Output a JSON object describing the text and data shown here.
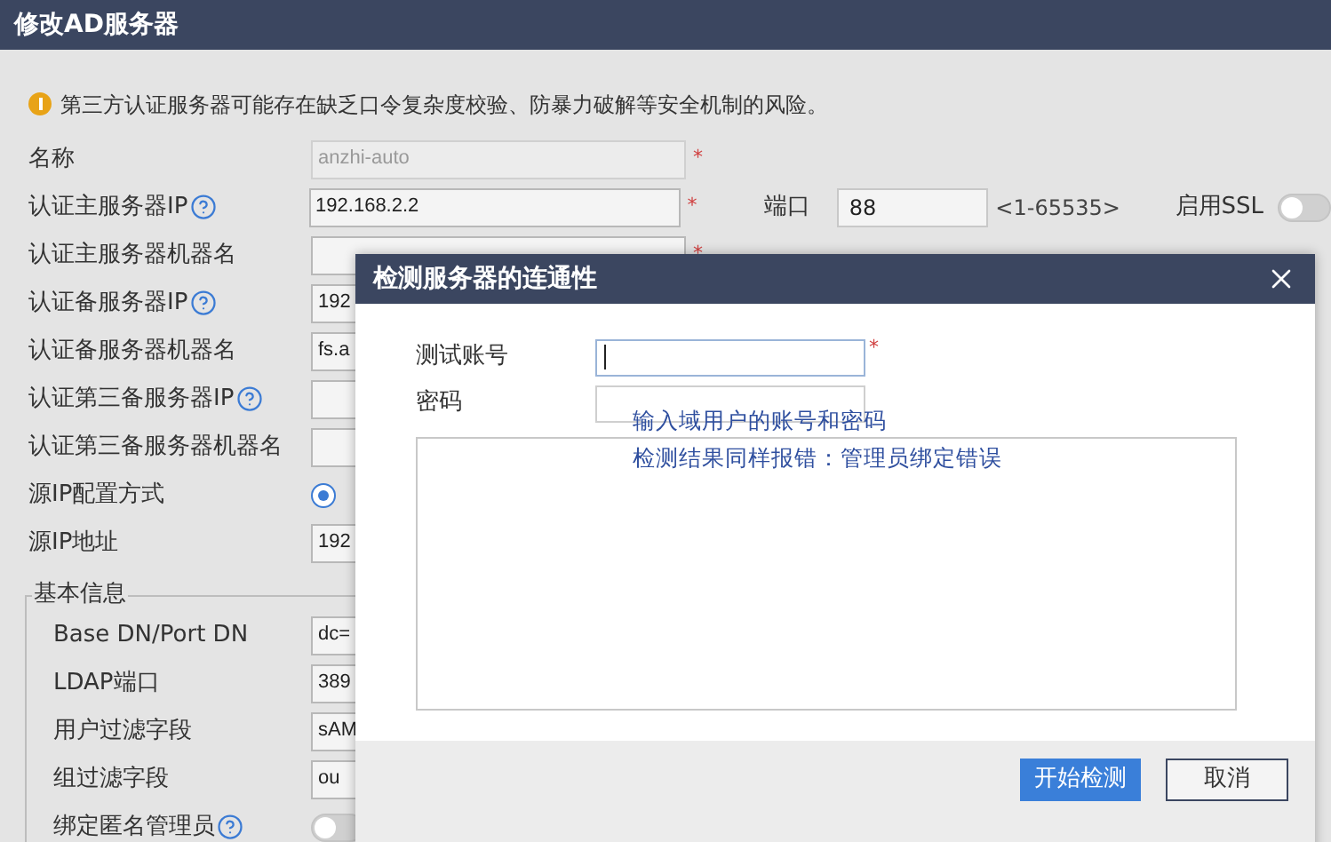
{
  "window": {
    "title": "修改AD服务器"
  },
  "warning": "第三方认证服务器可能存在缺乏口令复杂度校验、防暴力破解等安全机制的风险。",
  "rows": [
    {
      "kind": "text",
      "label": "名称",
      "value": "anzhi-auto",
      "disabled": true,
      "mark": "*"
    },
    {
      "kind": "text",
      "label": "认证主服务器IP",
      "value": "192.168.2.2",
      "mark": "*",
      "help": true
    },
    {
      "kind": "text",
      "label": "认证主服务器机器名",
      "mark": "*"
    },
    {
      "kind": "text",
      "label": "认证备服务器IP",
      "value": "192",
      "help": true
    },
    {
      "kind": "text",
      "label": "认证备服务器机器名",
      "value": "fs.a"
    },
    {
      "kind": "text",
      "label": "认证第三备服务器IP",
      "help": true
    },
    {
      "kind": "text",
      "label": "认证第三备服务器机器名"
    },
    {
      "kind": "radio",
      "label": "源IP配置方式",
      "selected": true
    },
    {
      "kind": "text",
      "label": "源IP地址",
      "value": "192"
    }
  ],
  "port": {
    "label": "端口",
    "value": "88",
    "range": "<1-65535>"
  },
  "ssl": {
    "label": "启用SSL",
    "on": false
  },
  "basic_info": {
    "legend": "基本信息",
    "rows": [
      {
        "kind": "text",
        "label": "Base DN/Port DN",
        "value": "dc="
      },
      {
        "kind": "text",
        "label": "LDAP端口",
        "value": "389"
      },
      {
        "kind": "text",
        "label": "用户过滤字段",
        "value": "sAM"
      },
      {
        "kind": "text",
        "label": "组过滤字段",
        "value": "ou"
      },
      {
        "kind": "toggle",
        "label": "绑定匿名管理员",
        "on": false,
        "help": true
      }
    ]
  },
  "dialog": {
    "title": "检测服务器的连通性",
    "fields": [
      {
        "label": "测试账号",
        "mark": "*",
        "focused": true
      },
      {
        "label": "密码",
        "focused": false
      }
    ],
    "annotations": [
      "输入域用户的账号和密码",
      "检测结果同样报错：管理员绑定错误"
    ],
    "buttons": [
      {
        "label": "开始检测",
        "kind": "primary"
      },
      {
        "label": "取消",
        "kind": "secondary"
      }
    ]
  }
}
